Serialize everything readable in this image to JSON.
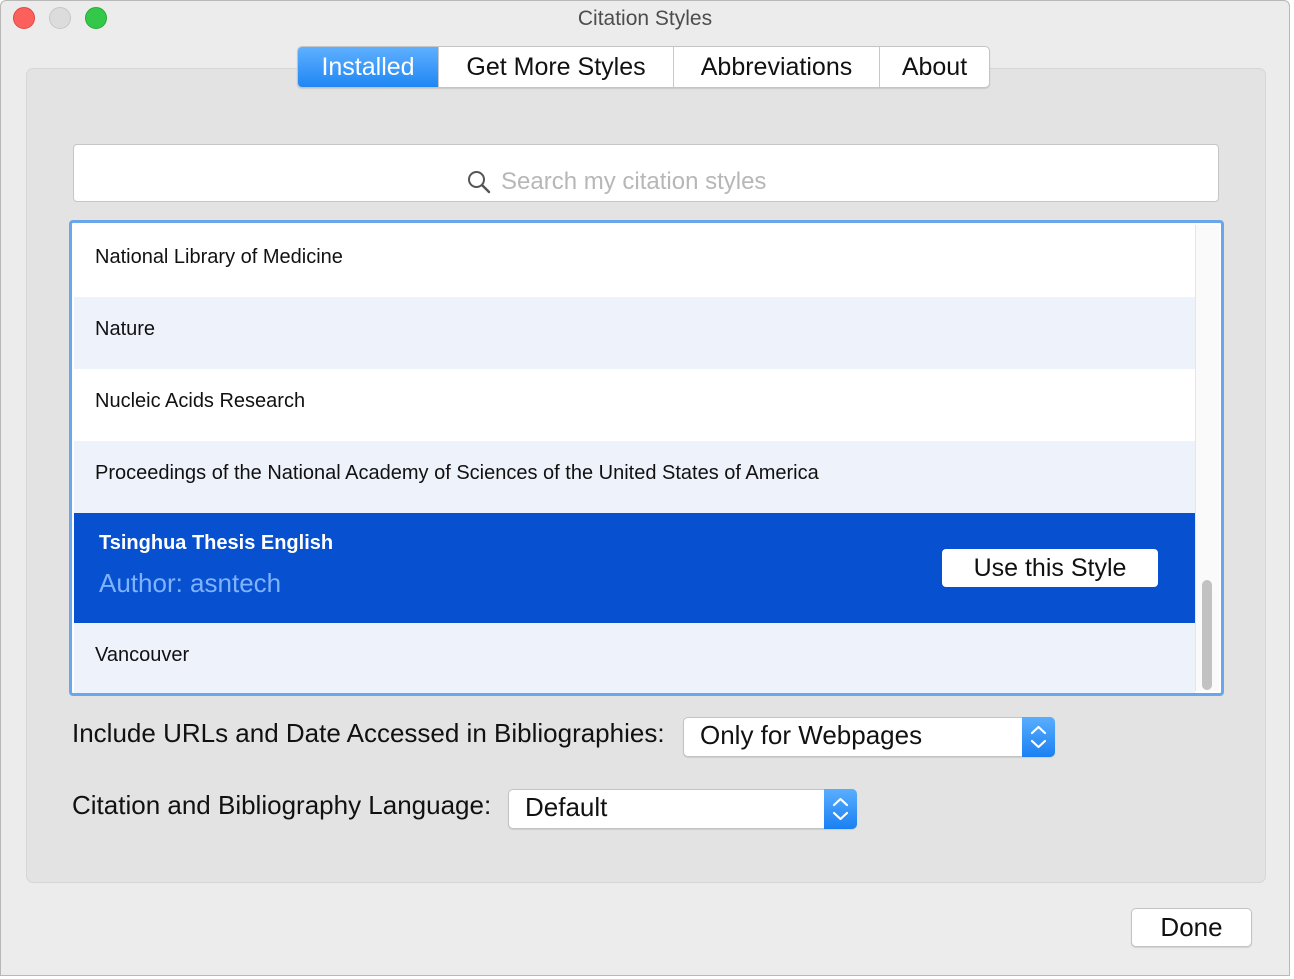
{
  "window": {
    "title": "Citation Styles"
  },
  "tabs": [
    {
      "label": "Installed",
      "active": true
    },
    {
      "label": "Get More Styles",
      "active": false
    },
    {
      "label": "Abbreviations",
      "active": false
    },
    {
      "label": "About",
      "active": false
    }
  ],
  "search": {
    "placeholder": "Search my citation styles",
    "value": ""
  },
  "styles_list": {
    "items": [
      {
        "name": "National Library of Medicine"
      },
      {
        "name": "Nature"
      },
      {
        "name": "Nucleic Acids Research"
      },
      {
        "name": "Proceedings of the National Academy of Sciences of the United States of America"
      },
      {
        "name": "Tsinghua Thesis English",
        "author": "Author: asntech",
        "selected": true,
        "action_label": "Use this Style"
      },
      {
        "name": "Vancouver"
      }
    ]
  },
  "settings": {
    "include_urls": {
      "label": "Include URLs and Date Accessed in Bibliographies:",
      "value": "Only for Webpages"
    },
    "language": {
      "label": "Citation and Bibliography Language:",
      "value": "Default"
    }
  },
  "footer": {
    "done_label": "Done"
  },
  "colors": {
    "selection": "#0750d0",
    "accent": "#1f86f4",
    "list_border": "#6aa6ec"
  }
}
